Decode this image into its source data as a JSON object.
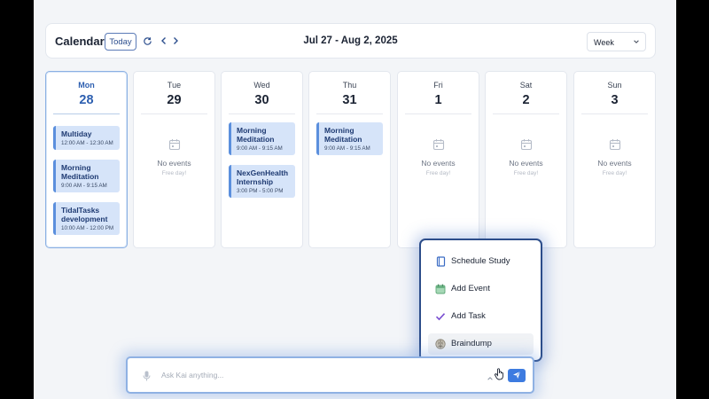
{
  "header": {
    "title": "Calendar",
    "today_label": "Today",
    "date_range": "Jul 27 - Aug 2, 2025",
    "view_select": "Week"
  },
  "days": [
    {
      "name": "Mon",
      "num": "28",
      "today": true,
      "events": [
        {
          "title": "Multiday",
          "time": "12:00 AM - 12:30 AM"
        },
        {
          "title": "Morning Meditation",
          "time": "9:00 AM - 9:15 AM"
        },
        {
          "title": "TidalTasks development",
          "time": "10:00 AM - 12:00 PM"
        }
      ]
    },
    {
      "name": "Tue",
      "num": "29",
      "empty_text": "No events",
      "empty_sub": "Free day!"
    },
    {
      "name": "Wed",
      "num": "30",
      "events": [
        {
          "title": "Morning Meditation",
          "time": "9:00 AM - 9:15 AM"
        },
        {
          "title": "NexGenHealth Internship",
          "time": "3:00 PM - 5:00 PM"
        }
      ]
    },
    {
      "name": "Thu",
      "num": "31",
      "events": [
        {
          "title": "Morning Meditation",
          "time": "9:00 AM - 9:15 AM"
        }
      ]
    },
    {
      "name": "Fri",
      "num": "1",
      "empty_text": "No events",
      "empty_sub": "Free day!"
    },
    {
      "name": "Sat",
      "num": "2",
      "empty_text": "No events",
      "empty_sub": "Free day!"
    },
    {
      "name": "Sun",
      "num": "3",
      "empty_text": "No events",
      "empty_sub": "Free day!"
    }
  ],
  "menu": {
    "items": [
      {
        "label": "Schedule Study",
        "icon": "book-icon"
      },
      {
        "label": "Add Event",
        "icon": "calendar-add-icon"
      },
      {
        "label": "Add Task",
        "icon": "checkmark-icon"
      },
      {
        "label": "Braindump",
        "icon": "brain-icon"
      }
    ]
  },
  "ask": {
    "placeholder": "Ask Kai anything..."
  },
  "colors": {
    "accent": "#3d7be0",
    "event_bg": "#d6e4f9",
    "event_border": "#5b8fdd",
    "menu_border": "#2c4d8a"
  }
}
